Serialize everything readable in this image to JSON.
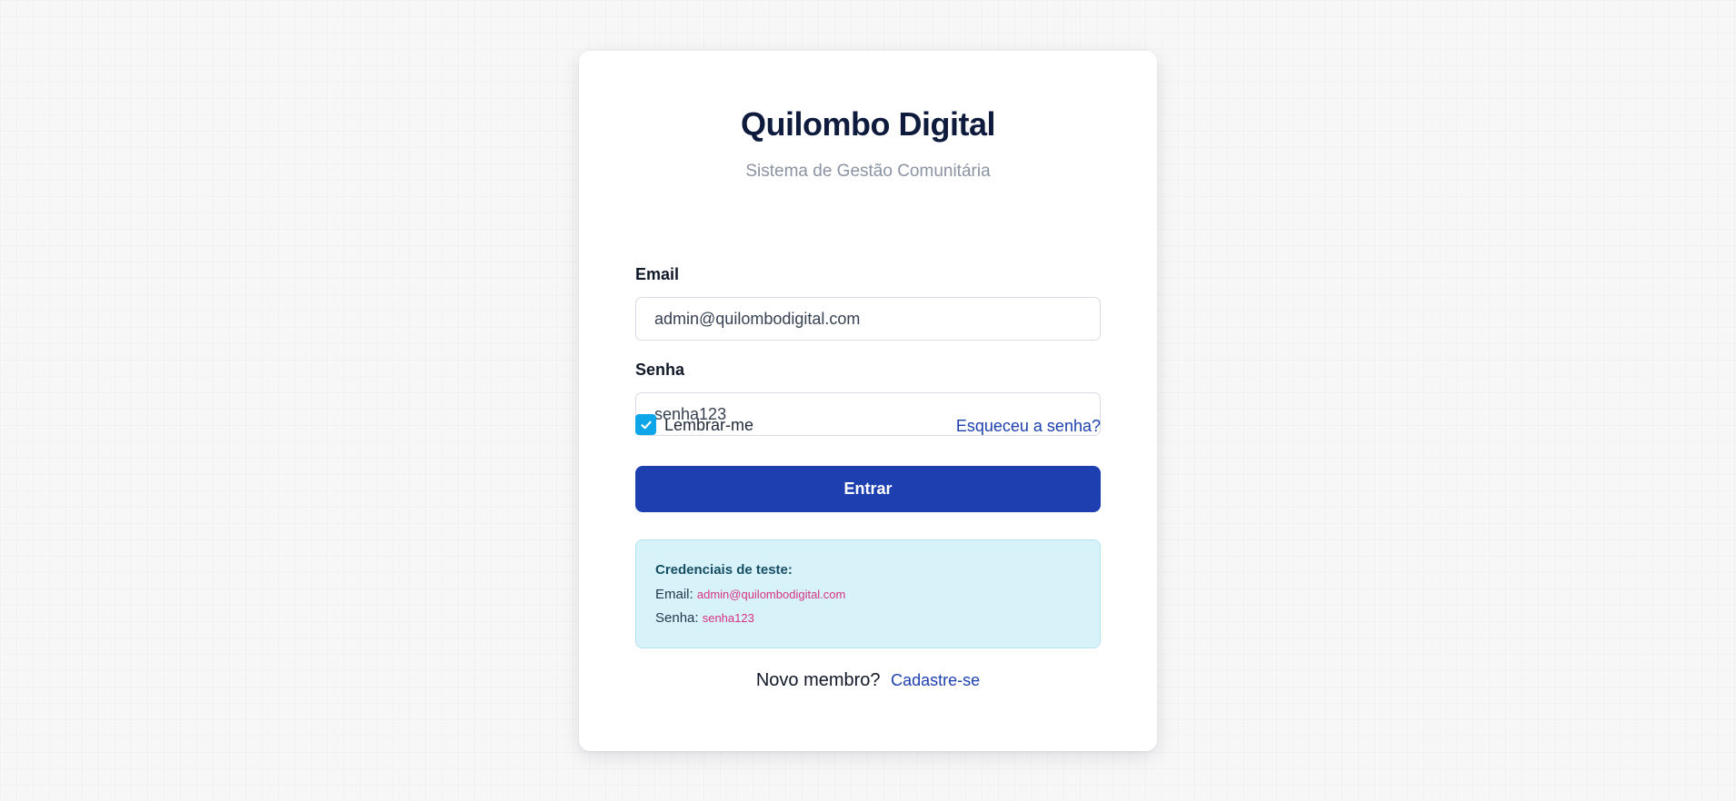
{
  "header": {
    "title": "Quilombo Digital",
    "subtitle": "Sistema de Gestão Comunitária"
  },
  "form": {
    "email_label": "Email",
    "email_value": "admin@quilombodigital.com",
    "password_label": "Senha",
    "password_value": "senha123",
    "remember_label": "Lembrar-me",
    "remember_checked": true,
    "forgot_link": "Esqueceu a senha?",
    "submit_label": "Entrar"
  },
  "test_credentials": {
    "heading": "Credenciais de teste:",
    "email_label": "Email:",
    "email_value": "admin@quilombodigital.com",
    "password_label": "Senha:",
    "password_value": "senha123"
  },
  "signup": {
    "prompt": "Novo membro?",
    "link": "Cadastre-se"
  },
  "colors": {
    "primary": "#1e3faf",
    "link": "#1e40af",
    "checkbox": "#0ea5e9",
    "info_background": "#d8f2fa",
    "code_text": "#d63384"
  }
}
